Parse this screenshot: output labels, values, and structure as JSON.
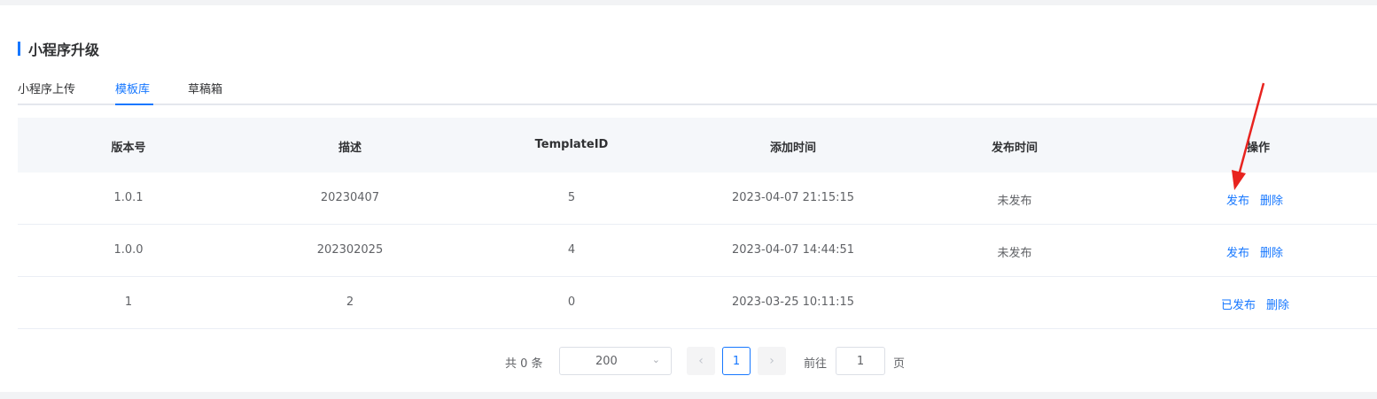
{
  "page": {
    "title": "小程序升级"
  },
  "tabs": [
    {
      "label": "小程序上传",
      "active": false
    },
    {
      "label": "模板库",
      "active": true
    },
    {
      "label": "草稿箱",
      "active": false
    }
  ],
  "table": {
    "headers": [
      "版本号",
      "描述",
      "TemplateID",
      "添加时间",
      "发布时间",
      "操作"
    ],
    "rows": [
      {
        "version": "1.0.1",
        "desc": "20230407",
        "template_id": "5",
        "added": "2023-04-07 21:15:15",
        "published": "未发布",
        "action1": "发布",
        "action2": "删除"
      },
      {
        "version": "1.0.0",
        "desc": "202302025",
        "template_id": "4",
        "added": "2023-04-07 14:44:51",
        "published": "未发布",
        "action1": "发布",
        "action2": "删除"
      },
      {
        "version": "1",
        "desc": "2",
        "template_id": "0",
        "added": "2023-03-25 10:11:15",
        "published": "",
        "action1": "已发布",
        "action2": "删除"
      }
    ]
  },
  "pagination": {
    "total_text": "共 0 条",
    "page_size": "200",
    "current_page": "1",
    "goto_label": "前往",
    "goto_value": "1",
    "page_unit": "页",
    "prev_icon": "chevron-left-icon",
    "next_icon": "chevron-right-icon"
  },
  "colors": {
    "accent": "#1677ff",
    "annotation_arrow": "#e8231f"
  }
}
